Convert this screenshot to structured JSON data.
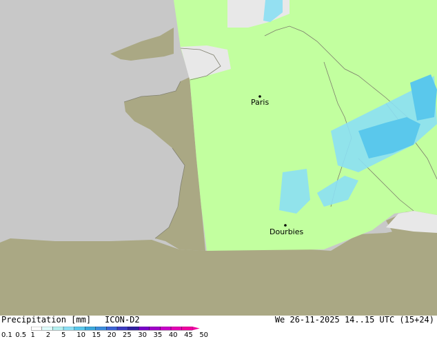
{
  "map": {
    "cities": [
      {
        "name": "Paris"
      },
      {
        "name": "Dourbies"
      }
    ]
  },
  "footer": {
    "title": "Precipitation [mm]",
    "model": "ICON-D2",
    "datetime": "We 26-11-2025 14..15 UTC (15+24)"
  },
  "legend": {
    "ticks": [
      "0.1",
      "0.5",
      "1",
      "2",
      "5",
      "10",
      "15",
      "20",
      "25",
      "30",
      "35",
      "40",
      "45",
      "50"
    ],
    "colors": [
      "#ffffff",
      "#e0fcfc",
      "#b4f0f0",
      "#8ce0f4",
      "#5ac8ec",
      "#3ca8dc",
      "#3c8cdc",
      "#3c64d4",
      "#3c3cc0",
      "#3020a0",
      "#7800c8",
      "#a000c8",
      "#c800c8",
      "#e400b4",
      "#f000a0"
    ],
    "domain_color": "#c2ff9f",
    "sea_color": "#c8c8c8",
    "land_color": "#aaa884"
  }
}
